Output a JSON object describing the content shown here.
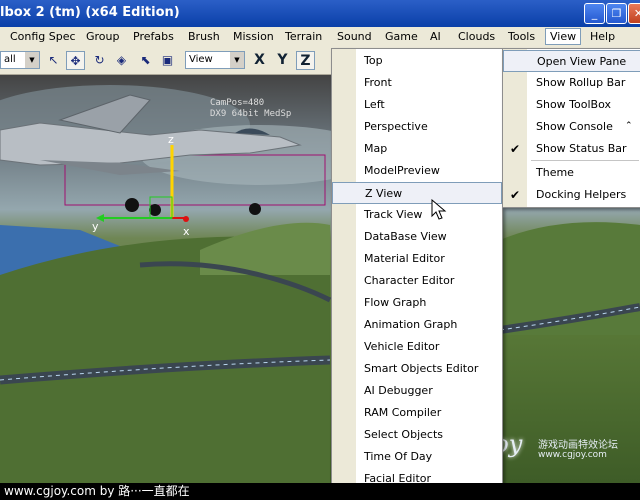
{
  "window": {
    "title": "lbox 2 (tm) (x64 Edition)"
  },
  "window_buttons": {
    "minimize": "_",
    "restore": "❐",
    "close": "✕"
  },
  "menubar": {
    "items": [
      "Config Spec",
      "Group",
      "Prefabs",
      "Brush",
      "Mission",
      "Terrain",
      "Sound",
      "Game",
      "AI",
      "Clouds",
      "Tools",
      "View",
      "Help"
    ]
  },
  "toolbar": {
    "layer_combo": "all",
    "view_combo": "View",
    "x_label": "X",
    "y_label": "Y",
    "z_label": "Z"
  },
  "viewport": {
    "hud_line1": "CamPos=480",
    "hud_line2": "DX9 64bit MedSp",
    "axis_x": "x",
    "axis_y": "y",
    "axis_z": "z"
  },
  "view_menu": {
    "items": [
      "Top",
      "Front",
      "Left",
      "Perspective",
      "Map",
      "ModelPreview",
      "Z View",
      "Track View",
      "DataBase View",
      "Material Editor",
      "Character Editor",
      "Flow Graph",
      "Animation Graph",
      "Vehicle Editor",
      "Smart Objects Editor",
      "AI Debugger",
      "RAM Compiler",
      "Select Objects",
      "Time Of Day",
      "Facial Editor"
    ],
    "highlighted": "Z View"
  },
  "sub_menu": {
    "items": [
      {
        "label": "Open View Pane",
        "checked": false,
        "highlighted": true
      },
      {
        "label": "Show Rollup Bar",
        "checked": false
      },
      {
        "label": "Show ToolBox",
        "checked": false
      },
      {
        "label": "Show Console",
        "checked": false
      },
      {
        "label": "Show Status Bar",
        "checked": true
      },
      {
        "label": "Theme",
        "checked": false
      },
      {
        "label": "Docking Helpers",
        "checked": true
      }
    ]
  },
  "statusbar": {
    "text": "www.cgjoy.com by 路···一直都在"
  },
  "watermark": {
    "logo": "cgjoy",
    "cn": "游戏动画特效论坛",
    "url": "www.cgjoy.com"
  },
  "colors": {
    "title_blue": "#0a3fa8",
    "menu_bg": "#ece9d8",
    "highlight_border": "#7f9db9",
    "axis_yellow": "#ffd400",
    "axis_green": "#22cc22",
    "axis_red": "#dd1111"
  },
  "icons": [
    "select-arrow-icon",
    "move-icon",
    "rotate-icon",
    "scale-icon",
    "select-terrain-icon",
    "snap-grid-icon",
    "check-icon",
    "mouse-cursor-icon"
  ]
}
